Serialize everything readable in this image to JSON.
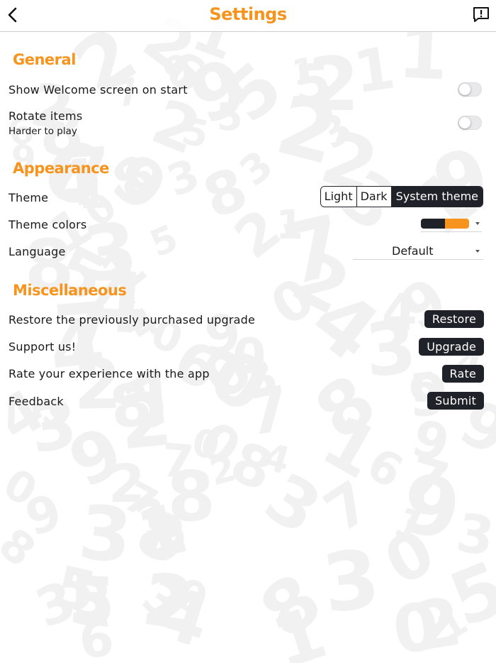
{
  "navbar": {
    "title": "Settings",
    "back_icon": "chevron-left-icon",
    "feedback_icon": "message-exclamation-icon"
  },
  "sections": {
    "general": {
      "title": "General",
      "show_welcome": {
        "label": "Show Welcome screen on start",
        "enabled": false
      },
      "rotate_items": {
        "label": "Rotate items",
        "sublabel": "Harder to play",
        "enabled": false
      }
    },
    "appearance": {
      "title": "Appearance",
      "theme": {
        "label": "Theme",
        "options": [
          "Light",
          "Dark",
          "System theme"
        ],
        "selected": "System theme"
      },
      "theme_colors": {
        "label": "Theme colors",
        "color_a": "#1f2228",
        "color_b": "#f7941d"
      },
      "language": {
        "label": "Language",
        "value": "Default"
      }
    },
    "miscellaneous": {
      "title": "Miscellaneous",
      "restore": {
        "label": "Restore the previously purchased upgrade",
        "button": "Restore"
      },
      "support": {
        "label": "Support us!",
        "button": "Upgrade"
      },
      "rate": {
        "label": "Rate your experience with the app",
        "button": "Rate"
      },
      "feedback": {
        "label": "Feedback",
        "button": "Submit"
      }
    }
  },
  "colors": {
    "accent": "#f7941d",
    "dark": "#1f2228"
  }
}
